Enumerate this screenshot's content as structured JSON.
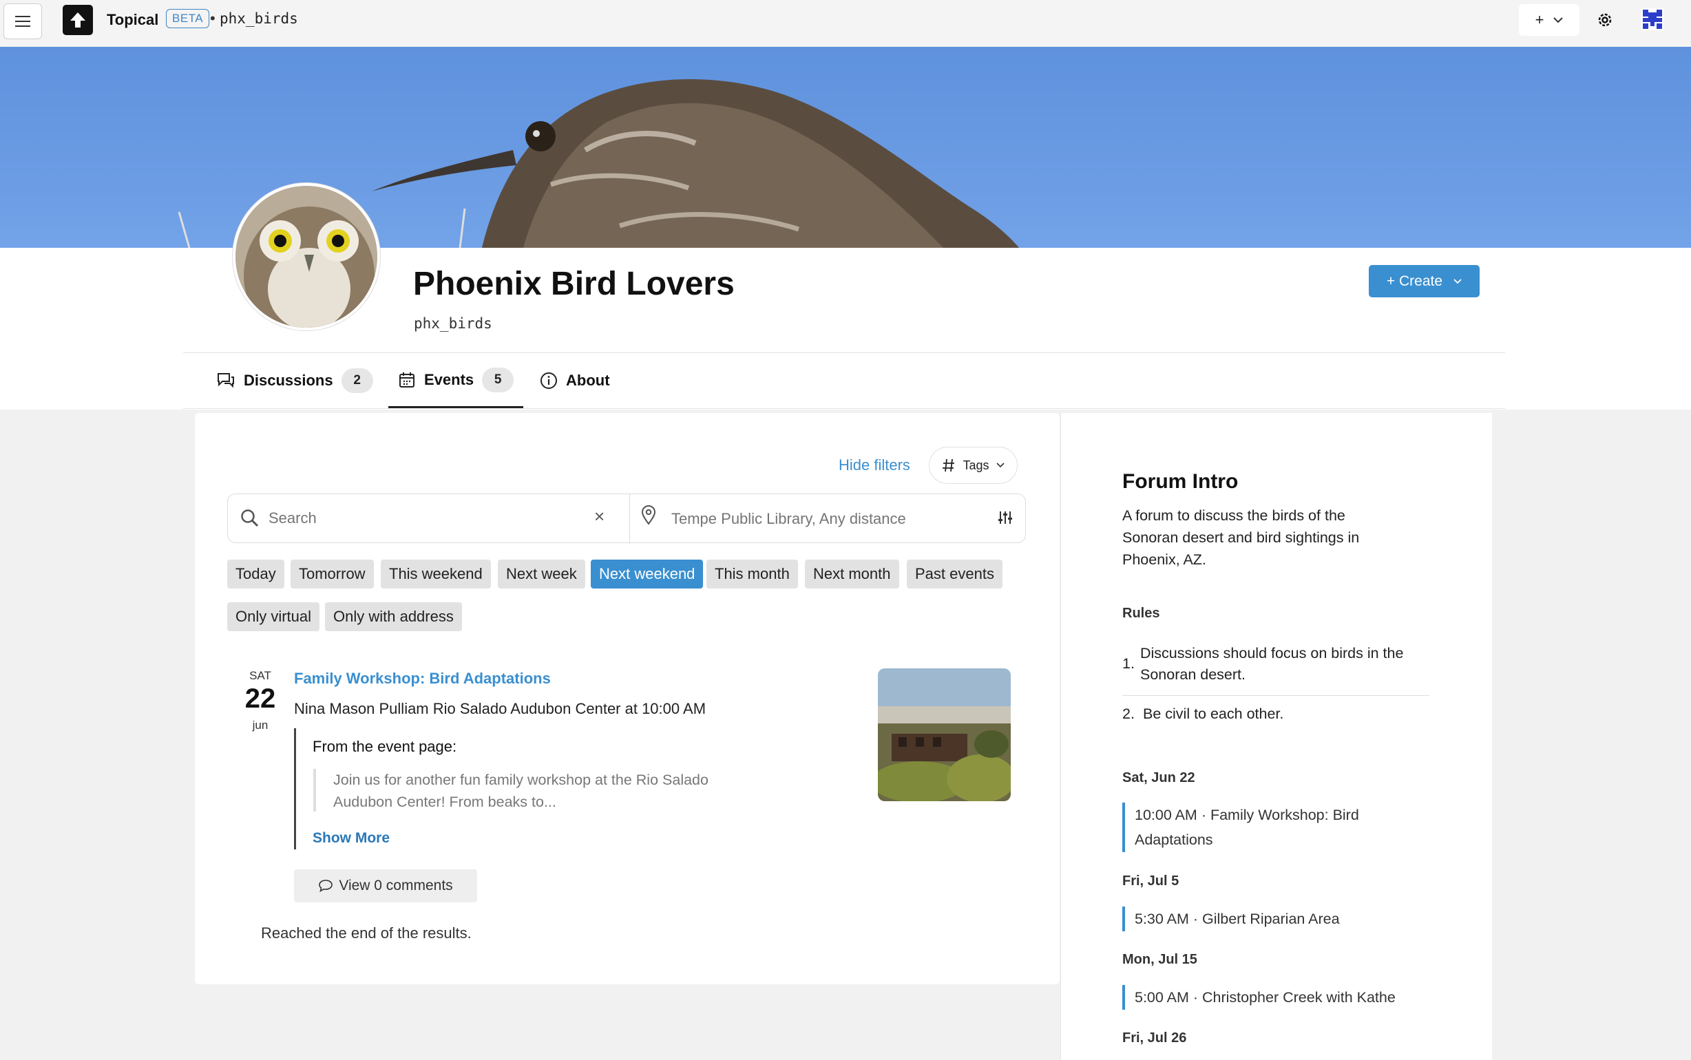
{
  "topbar": {
    "app_name": "Topical",
    "beta_label": "BETA",
    "separator": "•",
    "crumb": "phx_birds",
    "plus_label": "+"
  },
  "forum": {
    "title": "Phoenix Bird Lovers",
    "handle": "phx_birds",
    "create_label": "+ Create"
  },
  "tabs": [
    {
      "label": "Discussions",
      "count": "2"
    },
    {
      "label": "Events",
      "count": "5"
    },
    {
      "label": "About"
    }
  ],
  "filters": {
    "hide_filters": "Hide filters",
    "tags_label": "Tags",
    "search_placeholder": "Search",
    "location_placeholder": "Tempe Public Library, Any distance",
    "chips_row1": [
      "Today",
      "Tomorrow",
      "This weekend",
      "Next week",
      "Next weekend",
      "This month",
      "Next month",
      "Past events"
    ],
    "chips_row2": [
      "Only virtual",
      "Only with address"
    ],
    "selected_chip": "Next weekend"
  },
  "event": {
    "dow": "SAT",
    "day": "22",
    "month": "jun",
    "title": "Family Workshop: Bird Adaptations",
    "location": "Nina Mason Pulliam Rio Salado Audubon Center at 10:00 AM",
    "from_label": "From the event page:",
    "excerpt": "Join us for another fun family workshop at the Rio Salado Audubon Center! From beaks to...",
    "show_more": "Show More",
    "comments_label": "View 0 comments"
  },
  "end_text": "Reached the end of the results.",
  "sidebar": {
    "heading": "Forum Intro",
    "description": "A forum to discuss the birds of the Sonoran desert and bird sightings in Phoenix, AZ.",
    "rules_heading": "Rules",
    "rules": [
      {
        "num": "1.",
        "text": "Discussions should focus on birds in the Sonoran desert."
      },
      {
        "num": "2.",
        "text": "Be civil to each other."
      }
    ],
    "schedule": [
      {
        "day": "Sat, Jun 22",
        "item": "10:00 AM · Family Workshop: Bird Adaptations"
      },
      {
        "day": "Fri, Jul 5",
        "item": "5:30 AM · Gilbert Riparian Area"
      },
      {
        "day": "Mon, Jul 15",
        "item": "5:00 AM · Christopher Creek with Kathe"
      },
      {
        "day": "Fri, Jul 26",
        "item": ""
      }
    ]
  },
  "colors": {
    "accent": "#3a8fd0",
    "banner_sky": "#6a9be3"
  },
  "icons": [
    "menu-icon",
    "upload-arrow-icon",
    "chevron-down-icon",
    "gear-icon",
    "user-avatar-icon",
    "chat-icon",
    "calendar-icon",
    "info-icon",
    "hash-icon",
    "search-icon",
    "close-icon",
    "pin-icon",
    "tune-icon",
    "comment-icon"
  ]
}
